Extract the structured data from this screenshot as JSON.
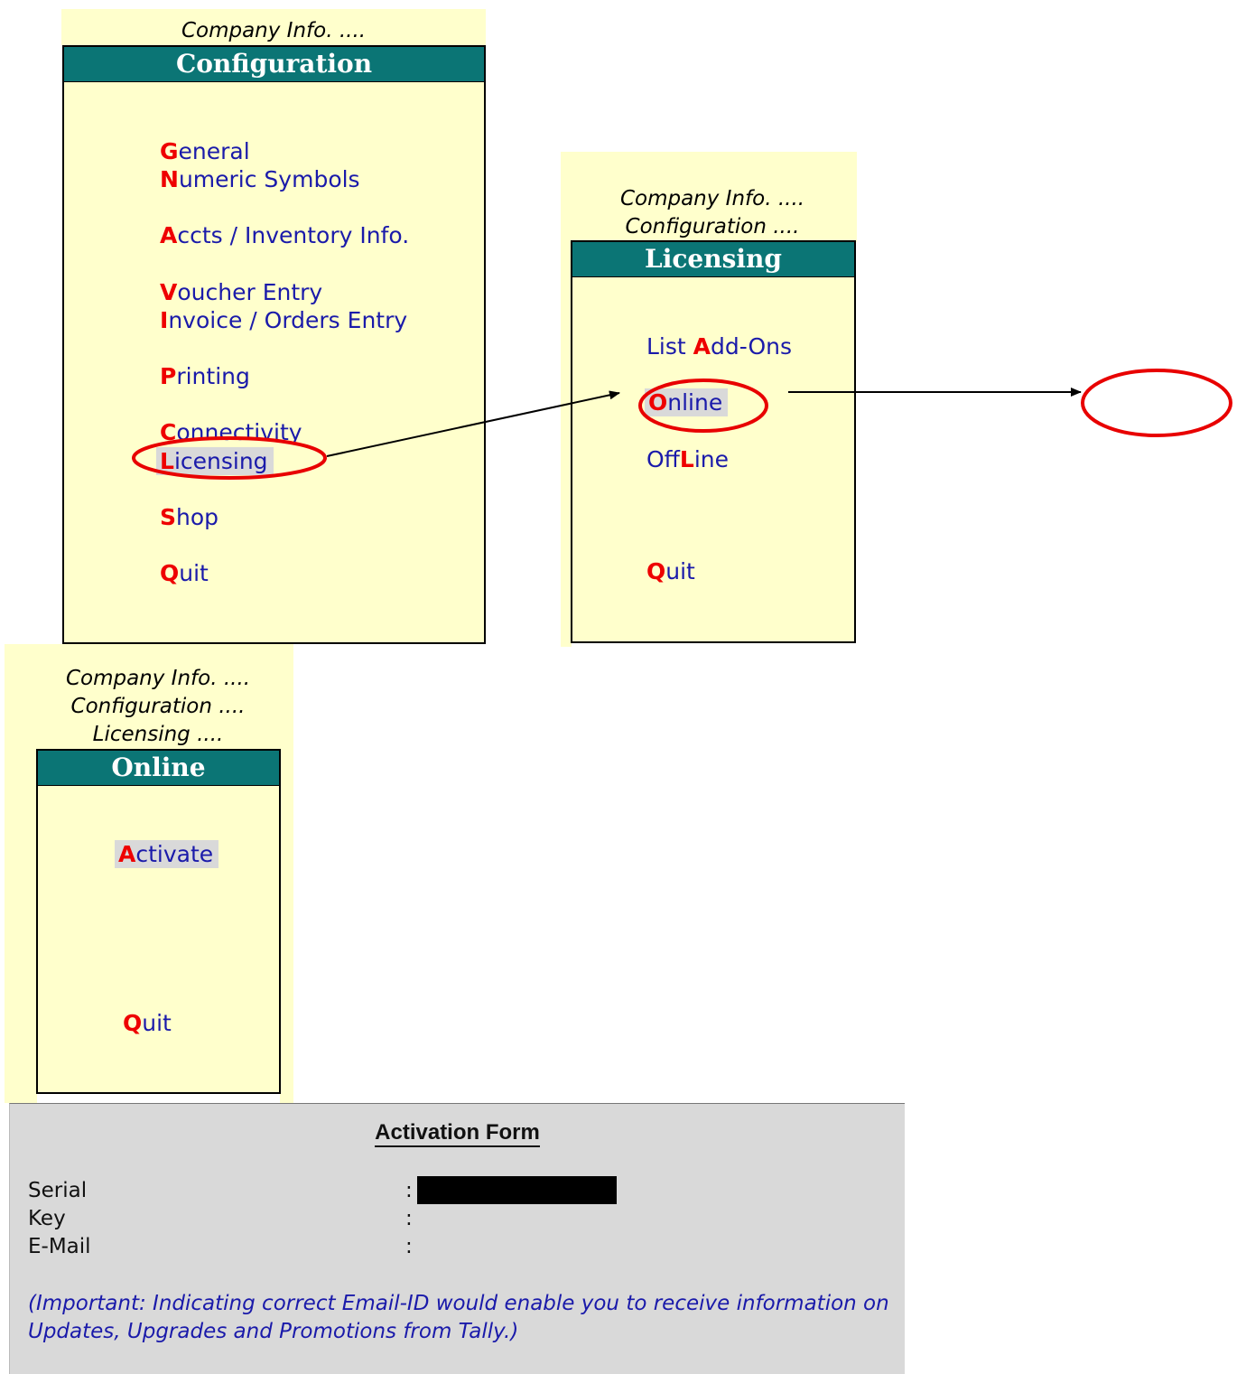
{
  "config_menu": {
    "breadcrumbs": [
      "Company Info. ...."
    ],
    "title": "Configuration",
    "items": [
      {
        "hotkey": "G",
        "rest": "eneral"
      },
      {
        "hotkey": "N",
        "rest": "umeric Symbols"
      },
      {
        "hotkey": "A",
        "rest": "ccts / Inventory Info."
      },
      {
        "hotkey": "V",
        "rest": "oucher Entry"
      },
      {
        "hotkey": "I",
        "rest": "nvoice / Orders Entry"
      },
      {
        "hotkey": "P",
        "rest": "rinting"
      },
      {
        "hotkey": "C",
        "rest": "onnectivity"
      },
      {
        "hotkey": "L",
        "rest": "icensing"
      },
      {
        "hotkey": "S",
        "rest": "hop"
      },
      {
        "hotkey": "Q",
        "rest": "uit"
      }
    ],
    "selected": "Licensing"
  },
  "licensing_menu": {
    "breadcrumbs": [
      "Company Info. ....",
      "Configuration ...."
    ],
    "title": "Licensing",
    "items": [
      {
        "pre": "List ",
        "hotkey": "A",
        "rest": "dd-Ons"
      },
      {
        "pre": "",
        "hotkey": "O",
        "rest": "nline"
      },
      {
        "pre": "Off",
        "hotkey": "L",
        "rest": "ine"
      },
      {
        "pre": "",
        "hotkey": "Q",
        "rest": "uit"
      }
    ],
    "selected": "Online"
  },
  "online_menu": {
    "breadcrumbs": [
      "Company Info. ....",
      "Configuration ....",
      "Licensing ...."
    ],
    "title": "Online",
    "items": [
      {
        "hotkey": "A",
        "rest": "ctivate"
      },
      {
        "hotkey": "Q",
        "rest": "uit"
      }
    ],
    "selected": "Activate"
  },
  "activation_form": {
    "title": "Activation Form",
    "fields": [
      {
        "label": "Serial",
        "separator": ":",
        "value_redacted": true
      },
      {
        "label": "Key",
        "separator": ":"
      },
      {
        "label": "E-Mail",
        "separator": ":"
      }
    ],
    "note_line1": "(Important: Indicating correct Email-ID would enable you to receive information on",
    "note_line2": "Updates, Upgrades and Promotions from Tally.)"
  },
  "colors": {
    "panel_bg": "#ffffcc",
    "title_bar": "#0b7575",
    "menu_text": "#1a1aaa",
    "hotkey": "#ee0000",
    "highlight_ellipse": "#e80000",
    "form_bg": "#d9d9d9"
  }
}
